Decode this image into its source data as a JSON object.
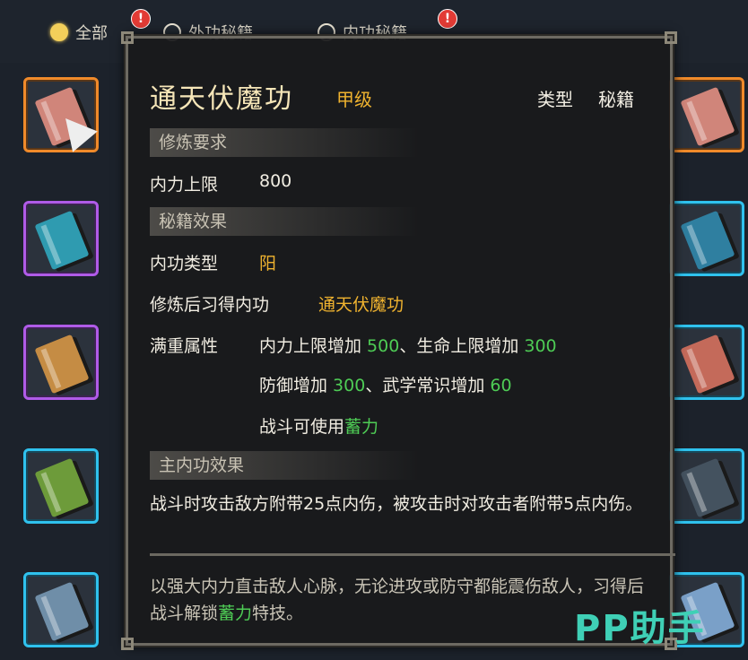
{
  "filters": [
    {
      "label": "全部",
      "selected": true,
      "badge": "!"
    },
    {
      "label": "外功秘籍",
      "selected": false,
      "badge": ""
    },
    {
      "label": "内功秘籍",
      "selected": false,
      "badge": "!"
    }
  ],
  "tooltip": {
    "title": "通天伏魔功",
    "grade": "甲级",
    "type_label": "类型",
    "type_value": "秘籍",
    "sections": {
      "requirements": "修炼要求",
      "effects": "秘籍效果",
      "main": "主内功效果"
    },
    "req_label": "内力上限",
    "req_value": "800",
    "inner_type_label": "内功类型",
    "inner_type_value": "阳",
    "learn_label": "修炼后习得内功",
    "learn_value": "通天伏魔功",
    "full_label": "满重属性",
    "attr1_a": "内力上限增加 ",
    "attr1_a_val": "500",
    "attr1_b": "、生命上限增加 ",
    "attr1_b_val": "300",
    "attr2_a": "防御增加 ",
    "attr2_a_val": "300",
    "attr2_b": "、武学常识增加 ",
    "attr2_b_val": "60",
    "attr3_a": "战斗可使用",
    "attr3_a_val": "蓄力",
    "main_effect": "战斗时攻击敌方附带25点内伤，被攻击时对攻击者附带5点内伤。",
    "flavor_a": "以强大内力直击敌人心脉，无论进攻或防守都能震伤敌人，习得后战斗解锁",
    "flavor_b": "蓄力",
    "flavor_c": "特技。"
  },
  "watermark": "PP助手",
  "colors": {
    "gold": "#f0b32f",
    "green": "#4ecc55",
    "orange": "#f08a2a",
    "purple": "#b05be8",
    "cyan": "#2fc2ee"
  },
  "icons": [
    "book-icon",
    "cursor-icon",
    "alert-icon"
  ]
}
